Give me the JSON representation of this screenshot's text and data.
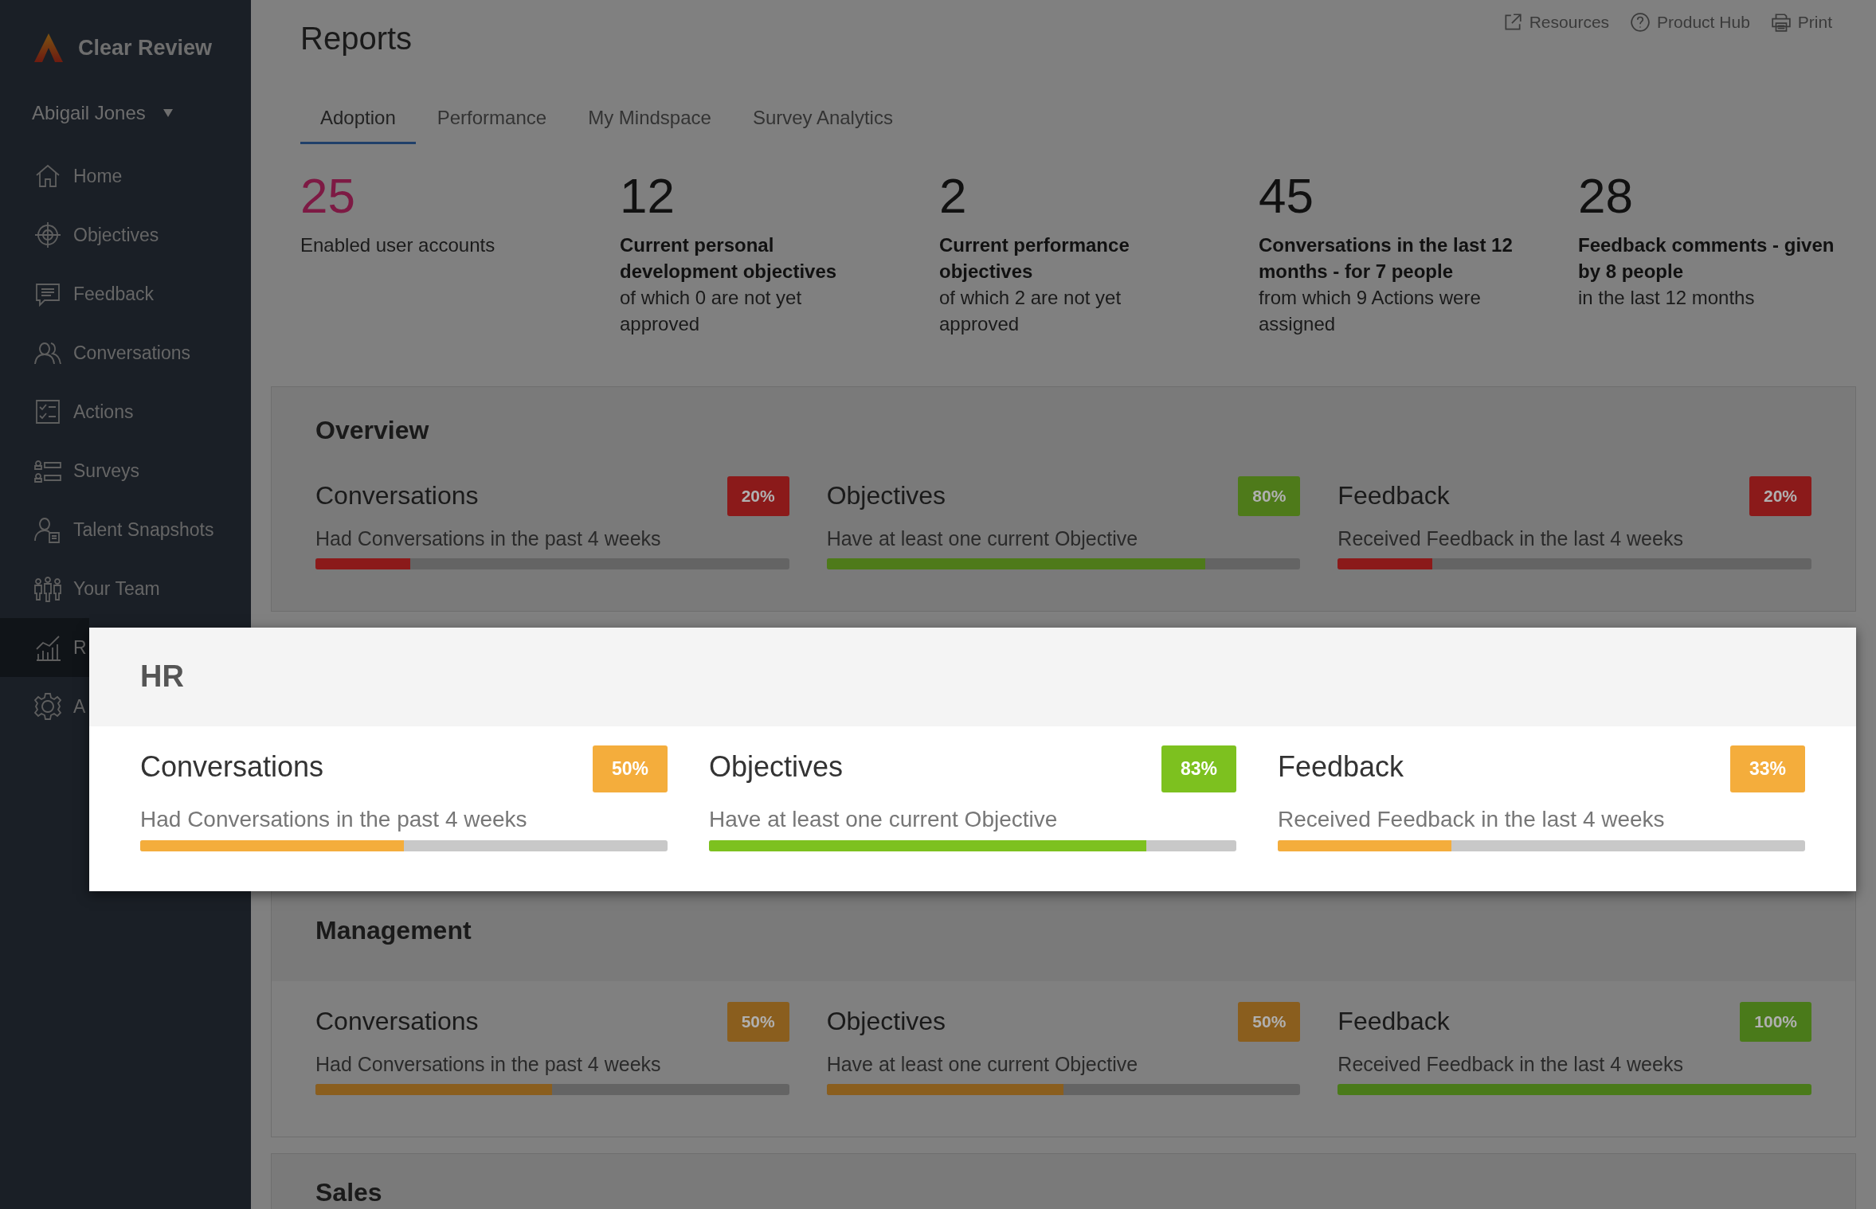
{
  "app": {
    "name": "Clear Review"
  },
  "user": {
    "name": "Abigail Jones"
  },
  "nav": [
    {
      "label": "Home",
      "selected": false
    },
    {
      "label": "Objectives",
      "selected": false
    },
    {
      "label": "Feedback",
      "selected": false
    },
    {
      "label": "Conversations",
      "selected": false
    },
    {
      "label": "Actions",
      "selected": false
    },
    {
      "label": "Surveys",
      "selected": false
    },
    {
      "label": "Talent Snapshots",
      "selected": false
    },
    {
      "label": "Your Team",
      "selected": false
    },
    {
      "label": "R",
      "selected": true
    },
    {
      "label": "A",
      "selected": false
    }
  ],
  "header": {
    "title": "Reports",
    "links": [
      "Resources",
      "Product Hub",
      "Print"
    ]
  },
  "tabs": [
    {
      "label": "Adoption",
      "selected": true
    },
    {
      "label": "Performance",
      "selected": false
    },
    {
      "label": "My Mindspace",
      "selected": false
    },
    {
      "label": "Survey Analytics",
      "selected": false
    }
  ],
  "stats": [
    {
      "number": "25",
      "color": "#7d1a44",
      "detail": "Enabled user accounts"
    },
    {
      "number": "12",
      "color": "#111111",
      "title": "Current personal development objectives",
      "detail": "of which 0 are not yet approved"
    },
    {
      "number": "2",
      "color": "#111111",
      "title": "Current performance objectives",
      "detail": "of which 2 are not yet approved"
    },
    {
      "number": "45",
      "color": "#111111",
      "title": "Conversations in the last 12 months - for 7 people",
      "detail": "from which 9 Actions were assigned"
    },
    {
      "number": "28",
      "color": "#111111",
      "title": "Feedback comments - given by 8 people",
      "detail": "in the last 12 months"
    }
  ],
  "sections": [
    {
      "name": "Overview",
      "kind": "overview",
      "spotlight": false,
      "metrics": [
        {
          "title": "Conversations",
          "badge": "20%",
          "description": "Had Conversations in the past 4 weeks",
          "level": 0.2,
          "color": "#8b1a1a"
        },
        {
          "title": "Objectives",
          "badge": "80%",
          "description": "Have at least one current Objective",
          "level": 0.8,
          "color": "#4e7a1a"
        },
        {
          "title": "Feedback",
          "badge": "20%",
          "description": "Received Feedback in the last 4 weeks",
          "level": 0.2,
          "color": "#8b1a1a"
        }
      ]
    },
    {
      "name": "HR",
      "kind": "team",
      "spotlight": true,
      "metrics": [
        {
          "title": "Conversations",
          "badge": "50%",
          "description": "Had Conversations in the past 4 weeks",
          "level": 0.5,
          "color": "#f4ad3c"
        },
        {
          "title": "Objectives",
          "badge": "83%",
          "description": "Have at least one current Objective",
          "level": 0.83,
          "color": "#7dc11f"
        },
        {
          "title": "Feedback",
          "badge": "33%",
          "description": "Received Feedback in the last 4 weeks",
          "level": 0.33,
          "color": "#f4ad3c"
        }
      ]
    },
    {
      "name": "Management",
      "kind": "team",
      "spotlight": false,
      "metrics": [
        {
          "title": "Conversations",
          "badge": "50%",
          "description": "Had Conversations in the past 4 weeks",
          "level": 0.5,
          "color": "#8a5e1e"
        },
        {
          "title": "Objectives",
          "badge": "50%",
          "description": "Have at least one current Objective",
          "level": 0.5,
          "color": "#8a5e1e"
        },
        {
          "title": "Feedback",
          "badge": "100%",
          "description": "Received Feedback in the last 4 weeks",
          "level": 1,
          "color": "#4a7a1a"
        }
      ]
    },
    {
      "name": "Sales",
      "kind": "team",
      "spotlight": false
    }
  ]
}
